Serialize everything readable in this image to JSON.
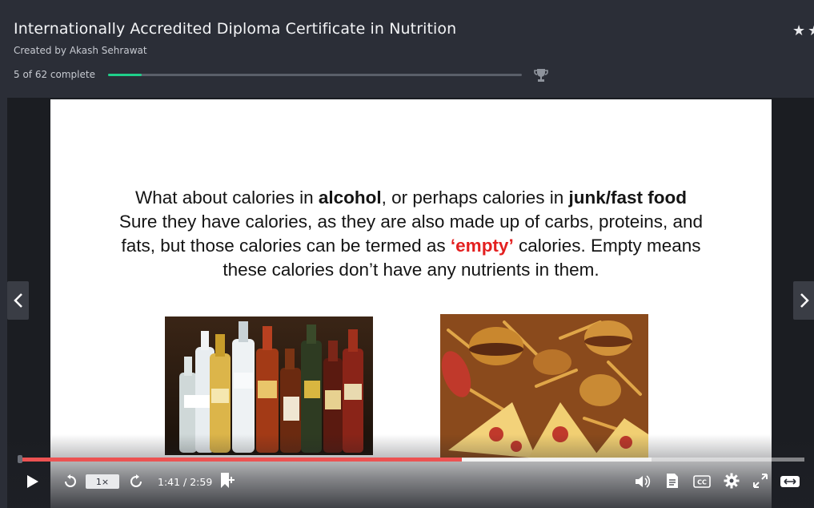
{
  "course": {
    "title": "Internationally Accredited Diploma Certificate in Nutrition",
    "author": "Created by Akash Sehrawat",
    "progress_text": "5 of 62 complete",
    "progress_fraction": 0.0806
  },
  "slide": {
    "line1_a": "What about calories in ",
    "line1_b": "alcohol",
    "line1_c": ", or perhaps calories in ",
    "line1_d": "junk/fast food",
    "line2": "Sure they have calories, as they are also made up of carbs, proteins, and",
    "line3_a": "fats, but those calories can be termed as ",
    "line3_b": "‘empty’",
    "line3_c": " calories. Empty means",
    "line4": "these calories don’t have any nutrients in them."
  },
  "player": {
    "speed_label": "1×",
    "time_label": "1:41 / 2:59",
    "played_fraction": 0.564,
    "buffered_fraction": 0.806
  },
  "colors": {
    "progress": "#1fcf8a",
    "scrubber": "#ec5252",
    "highlight": "#e32020"
  },
  "icons": [
    "trophy-icon",
    "star-icon",
    "chevron-left-icon",
    "chevron-right-icon",
    "play-icon",
    "rewind-icon",
    "forward-icon",
    "bookmark-add-icon",
    "volume-icon",
    "transcript-icon",
    "cc-icon",
    "gear-icon",
    "fullscreen-icon",
    "expand-icon"
  ]
}
